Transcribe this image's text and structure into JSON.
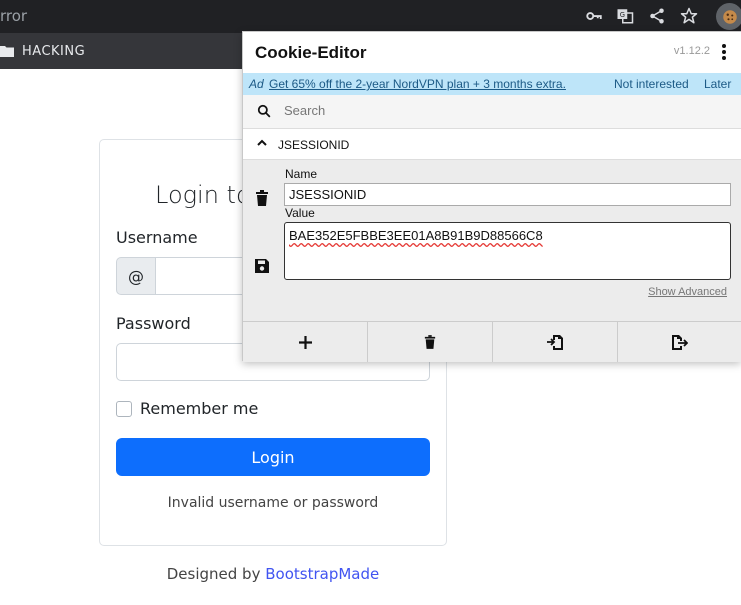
{
  "browser": {
    "url_fragment": "rror",
    "bookmark_label": "HACKING",
    "toolbar_icons": [
      "key-icon",
      "translate-icon",
      "share-icon",
      "star-icon",
      "cookie-extension-icon"
    ]
  },
  "login_page": {
    "title": "Login to",
    "username_label": "Username",
    "username_prefix": "@",
    "password_label": "Password",
    "remember_label": "Remember me",
    "login_button": "Login",
    "error_message": "Invalid username or password",
    "footer_prefix": "Designed by ",
    "footer_link": "BootstrapMade",
    "accent_color": "#0d6efd"
  },
  "cookie_editor": {
    "title": "Cookie-Editor",
    "version": "v1.12.2",
    "ad": {
      "tag": "Ad",
      "link_text": "Get 65% off the 2-year NordVPN plan + 3 months extra.",
      "dismiss": "Not interested",
      "later": "Later"
    },
    "search_placeholder": "Search",
    "cookie": {
      "header": "JSESSIONID",
      "name_label": "Name",
      "name_value": "JSESSIONID",
      "value_label": "Value",
      "value_value": "BAE352E5FBBE3EE01A8B91B9D88566C8"
    },
    "show_advanced": "Show Advanced",
    "footer_buttons": [
      "add-icon",
      "delete-all-icon",
      "import-icon",
      "export-icon"
    ]
  }
}
